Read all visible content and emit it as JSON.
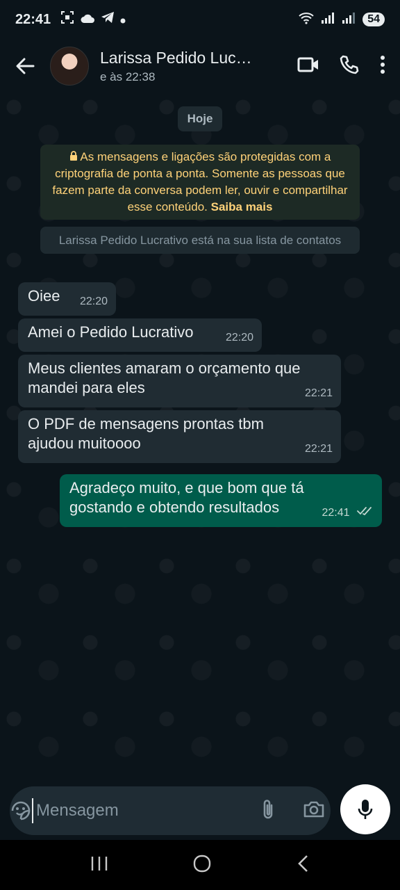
{
  "status": {
    "time": "22:41",
    "battery": "54"
  },
  "header": {
    "contact_name": "Larissa Pedido Lucrativo",
    "last_seen": "e às 22:38"
  },
  "chat": {
    "day_label": "Hoje",
    "encryption_notice": "As mensagens e ligações são protegidas com a criptografia de ponta a ponta. Somente as pessoas que fazem parte da conversa podem ler, ouvir e compartilhar esse conteúdo.",
    "learn_more": "Saiba mais",
    "contact_notice": "Larissa Pedido Lucrativo está na sua lista de contatos",
    "messages": [
      {
        "direction": "in",
        "text": "Oiee",
        "time": "22:20"
      },
      {
        "direction": "in",
        "text": "Amei o Pedido Lucrativo",
        "time": "22:20"
      },
      {
        "direction": "in",
        "text": "Meus clientes amaram o orçamento que mandei para eles",
        "time": "22:21"
      },
      {
        "direction": "in",
        "text": "O PDF de mensagens prontas tbm ajudou muitoooo",
        "time": "22:21"
      },
      {
        "direction": "out",
        "text": "Agradeço muito, e que bom que tá gostando e obtendo resultados",
        "time": "22:41",
        "status": "read"
      }
    ]
  },
  "composer": {
    "placeholder": "Mensagem"
  },
  "colors": {
    "background": "#0b141a",
    "incoming_bubble": "#202c33",
    "outgoing_bubble": "#005c4b",
    "encryption_text": "#ffd279"
  }
}
